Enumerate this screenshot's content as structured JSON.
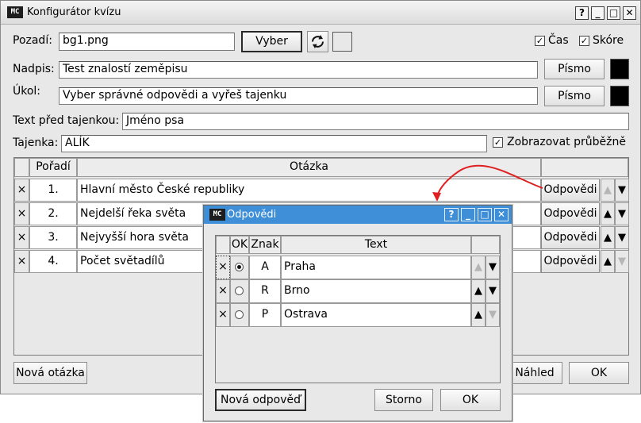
{
  "window": {
    "app_icon": "MC",
    "title": "Konfigurátor kvízu",
    "buttons": [
      "?",
      "_",
      "□",
      "✕"
    ]
  },
  "form": {
    "background_label": "Pozadí:",
    "background_value": "bg1.png",
    "choose_button": "Vyber",
    "reset_icon": "refresh-icon",
    "time_label": "Čas",
    "score_label": "Skóre",
    "heading_label": "Nadpis:",
    "heading_value": "Test znalostí zeměpisu",
    "task_label": "Úkol:",
    "task_value": "Vyber správné odpovědi a vyřeš tajenku",
    "font_button": "Písmo",
    "pre_text_label": "Text před tajenkou:",
    "pre_text_value": "Jméno psa",
    "secret_label": "Tajenka:",
    "secret_value": "ALÍK",
    "show_progress_label": "Zobrazovat průběžně",
    "swatch_white": "#ffffff",
    "swatch_black": "#000000"
  },
  "questions": {
    "col_order": "Pořadí",
    "col_question": "Otázka",
    "delete_glyph": "×",
    "answers_button": "Odpovědi",
    "rows": [
      {
        "order": "1.",
        "question": "Hlavní město České republiky"
      },
      {
        "order": "2.",
        "question": "Nejdelší řeka světa"
      },
      {
        "order": "3.",
        "question": "Nejvyšší hora světa"
      },
      {
        "order": "4.",
        "question": "Počet světadílů"
      }
    ]
  },
  "footer": {
    "new_question": "Nová otázka",
    "preview": "Náhled",
    "ok": "OK"
  },
  "dialog": {
    "title": "Odpovědi",
    "buttons": [
      "?",
      "_",
      "□",
      "✕"
    ],
    "col_ok": "OK",
    "col_letter": "Znak",
    "col_text": "Text",
    "answers": [
      {
        "letter": "A",
        "text": "Praha",
        "correct": true
      },
      {
        "letter": "R",
        "text": "Brno",
        "correct": false
      },
      {
        "letter": "P",
        "text": "Ostrava",
        "correct": false
      }
    ],
    "new_answer": "Nová odpověď",
    "cancel": "Storno",
    "ok": "OK"
  },
  "colors": {
    "dialog_title_bg": "#3e8fd8",
    "annotation_arrow": "#e02020"
  }
}
